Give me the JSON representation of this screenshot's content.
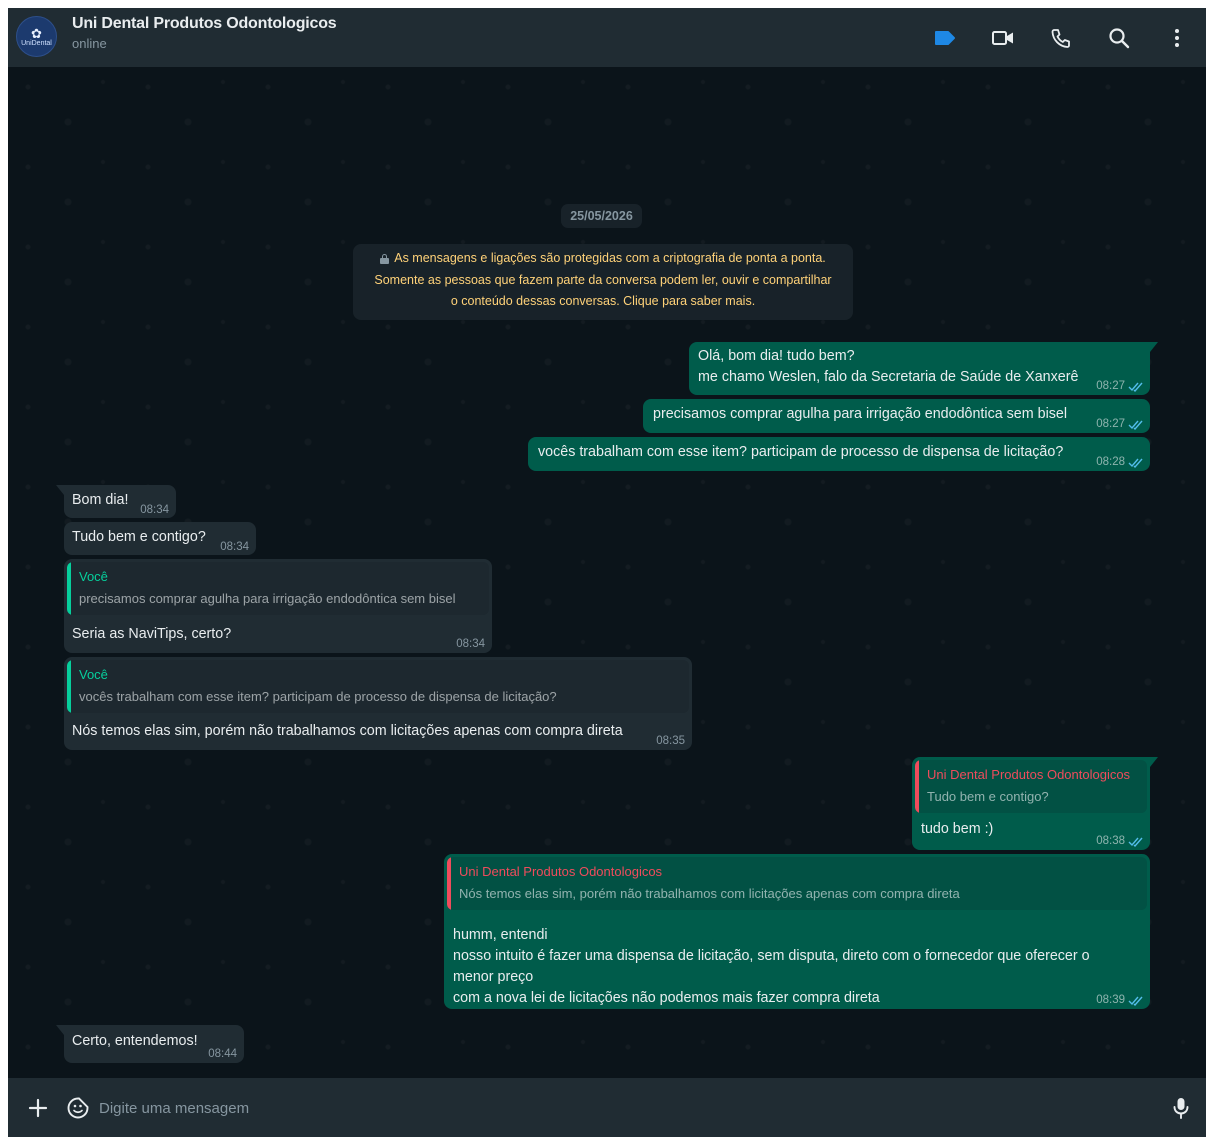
{
  "header": {
    "contact_name": "Uni Dental Produtos Odontologicos",
    "status": "online",
    "avatar_text": "UniDental",
    "icons": [
      "label-icon",
      "video-call-icon",
      "voice-call-icon",
      "search-icon",
      "menu-icon"
    ],
    "label_color": "#1e88e5"
  },
  "chat": {
    "date": "25/05/2026",
    "encryption_notice": {
      "line1": "As mensagens e ligações são protegidas com a criptografia de ponta a ponta.",
      "line2": "Somente as pessoas que fazem parte da conversa podem ler, ouvir e compartilhar",
      "line3": "o conteúdo dessas conversas. Clique para saber mais."
    },
    "messages": [
      {
        "direction": "out",
        "lines": [
          "Olá, bom dia! tudo bem?",
          "me chamo Weslen, falo da Secretaria de Saúde de Xanxerê"
        ],
        "time": "08:27",
        "read": true
      },
      {
        "direction": "out",
        "lines": [
          "precisamos comprar agulha para irrigação endodôntica sem bisel"
        ],
        "time": "08:27",
        "read": true
      },
      {
        "direction": "out",
        "lines": [
          "vocês trabalham com esse item? participam de processo de dispensa de licitação?"
        ],
        "time": "08:28",
        "read": true
      },
      {
        "direction": "in",
        "lines": [
          "Bom dia!"
        ],
        "time": "08:34"
      },
      {
        "direction": "in",
        "lines": [
          "Tudo bem e contigo?"
        ],
        "time": "08:34"
      },
      {
        "direction": "in",
        "quote": {
          "author": "Você",
          "text": "precisamos comprar agulha para irrigação endodôntica sem bisel"
        },
        "lines": [
          "Seria as NaviTips, certo?"
        ],
        "time": "08:34"
      },
      {
        "direction": "in",
        "quote": {
          "author": "Você",
          "text": "vocês trabalham com esse item? participam de processo de dispensa de licitação?"
        },
        "lines": [
          "Nós temos elas sim, porém não trabalhamos com licitações apenas com compra direta"
        ],
        "time": "08:35"
      },
      {
        "direction": "out",
        "quote": {
          "author": "Uni Dental Produtos Odontologicos",
          "text": "Tudo bem e contigo?"
        },
        "lines": [
          "tudo bem :)"
        ],
        "time": "08:38",
        "read": true
      },
      {
        "direction": "out",
        "quote": {
          "author": "Uni Dental Produtos Odontologicos",
          "text": "Nós temos elas sim, porém não trabalhamos com licitações apenas com compra direta"
        },
        "lines": [
          "humm, entendi",
          "nosso intuito é fazer uma dispensa de licitação, sem disputa, direto com o fornecedor que oferecer o",
          "menor preço",
          "com a nova lei de licitações não podemos mais fazer compra direta"
        ],
        "time": "08:39",
        "read": true
      },
      {
        "direction": "in",
        "lines": [
          "Certo, entendemos!"
        ],
        "time": "08:44"
      }
    ],
    "colors": {
      "outgoing_bubble": "#005c4b",
      "incoming_bubble": "#202c33",
      "quote_you": "#06cf9c",
      "quote_contact": "#ef4c5c",
      "read_ticks": "#53bdeb"
    }
  },
  "composer": {
    "placeholder": "Digite uma mensagem",
    "icons": [
      "attach-plus-icon",
      "sticker-icon",
      "microphone-icon"
    ]
  }
}
